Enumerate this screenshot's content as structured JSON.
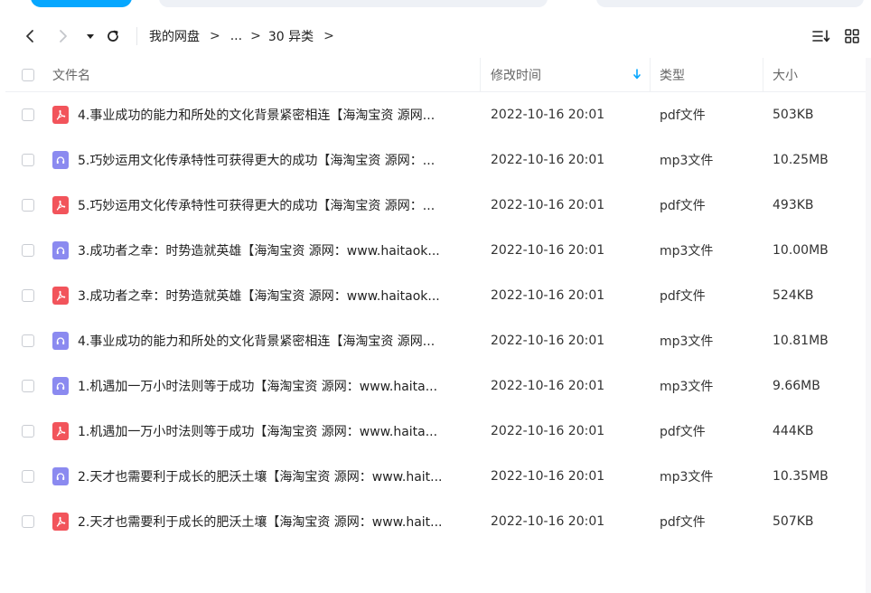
{
  "nav": {
    "breadcrumb": [
      "我的网盘",
      "...",
      "30 异类"
    ],
    "separator": ">"
  },
  "table": {
    "headers": {
      "name": "文件名",
      "time": "修改时间",
      "type": "类型",
      "size": "大小"
    },
    "rows": [
      {
        "kind": "pdf",
        "name": "4.事业成功的能力和所处的文化背景紧密相连【海淘宝资 源网...",
        "time": "2022-10-16 20:01",
        "type": "pdf文件",
        "size": "503KB"
      },
      {
        "kind": "mp3",
        "name": "5.巧妙运用文化传承特性可获得更大的成功【海淘宝资 源网：...",
        "time": "2022-10-16 20:01",
        "type": "mp3文件",
        "size": "10.25MB"
      },
      {
        "kind": "pdf",
        "name": "5.巧妙运用文化传承特性可获得更大的成功【海淘宝资 源网：...",
        "time": "2022-10-16 20:01",
        "type": "pdf文件",
        "size": "493KB"
      },
      {
        "kind": "mp3",
        "name": "3.成功者之幸：时势造就英雄【海淘宝资 源网：www.haitaok...",
        "time": "2022-10-16 20:01",
        "type": "mp3文件",
        "size": "10.00MB"
      },
      {
        "kind": "pdf",
        "name": "3.成功者之幸：时势造就英雄【海淘宝资 源网：www.haitaok...",
        "time": "2022-10-16 20:01",
        "type": "pdf文件",
        "size": "524KB"
      },
      {
        "kind": "mp3",
        "name": "4.事业成功的能力和所处的文化背景紧密相连【海淘宝资 源网...",
        "time": "2022-10-16 20:01",
        "type": "mp3文件",
        "size": "10.81MB"
      },
      {
        "kind": "mp3",
        "name": "1.机遇加一万小时法则等于成功【海淘宝资 源网：www.haita...",
        "time": "2022-10-16 20:01",
        "type": "mp3文件",
        "size": "9.66MB"
      },
      {
        "kind": "pdf",
        "name": "1.机遇加一万小时法则等于成功【海淘宝资 源网：www.haita...",
        "time": "2022-10-16 20:01",
        "type": "pdf文件",
        "size": "444KB"
      },
      {
        "kind": "mp3",
        "name": "2.天才也需要利于成长的肥沃土壤【海淘宝资 源网：www.hait...",
        "time": "2022-10-16 20:01",
        "type": "mp3文件",
        "size": "10.35MB"
      },
      {
        "kind": "pdf",
        "name": "2.天才也需要利于成长的肥沃土壤【海淘宝资 源网：www.hait...",
        "time": "2022-10-16 20:01",
        "type": "pdf文件",
        "size": "507KB"
      }
    ]
  },
  "colors": {
    "accent": "#06a7ff",
    "pdf_icon": "#f2545b",
    "mp3_icon": "#8b8af0"
  },
  "icons": {
    "back": "chevron-left-icon",
    "forward": "chevron-right-icon",
    "history": "caret-down-icon",
    "refresh": "refresh-icon",
    "sort": "sort-icon",
    "view": "grid-view-icon",
    "sort_dir": "arrow-down-icon"
  }
}
